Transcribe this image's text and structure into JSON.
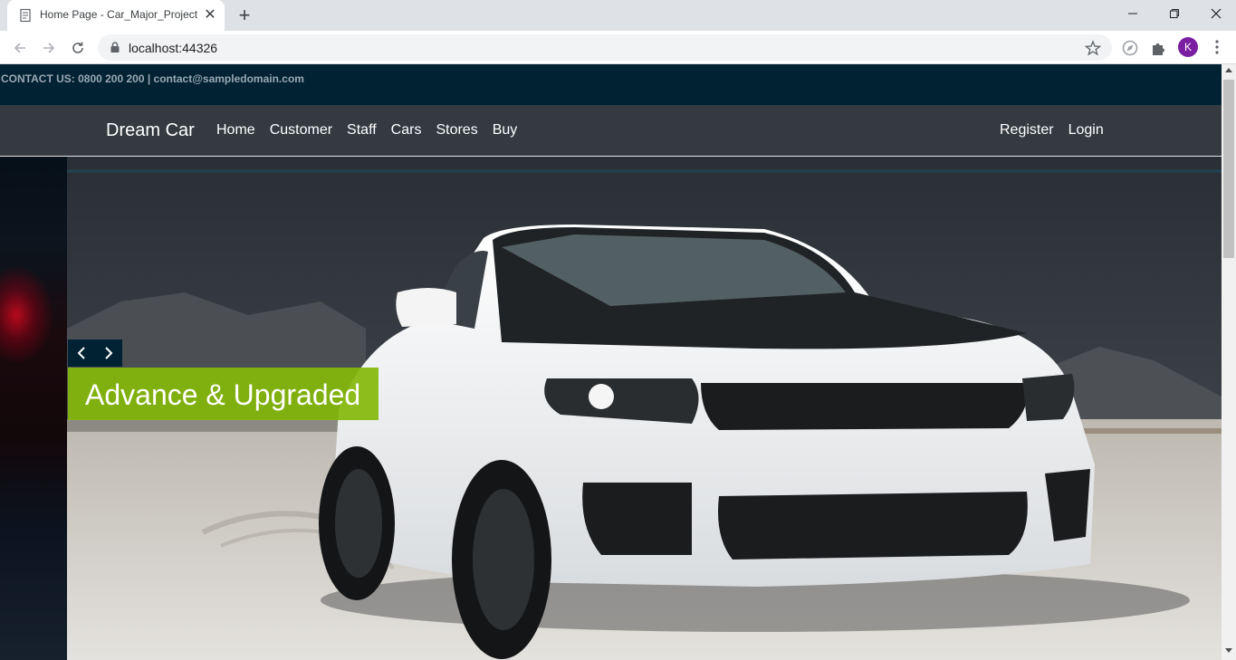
{
  "browser": {
    "tab_title": "Home Page - Car_Major_Project",
    "url": "localhost:44326",
    "profile_initial": "K"
  },
  "contact": {
    "text": "CONTACT US: 0800 200 200 | contact@sampledomain.com"
  },
  "navbar": {
    "brand": "Dream Car",
    "links": [
      "Home",
      "Customer",
      "Staff",
      "Cars",
      "Stores",
      "Buy"
    ],
    "right_links": [
      "Register",
      "Login"
    ]
  },
  "carousel": {
    "caption": "Advance & Upgraded"
  },
  "colors": {
    "contact_bar": "#012233",
    "navbar": "#343a40",
    "caption_bg": "#84b80b",
    "profile": "#7b1fa2"
  }
}
